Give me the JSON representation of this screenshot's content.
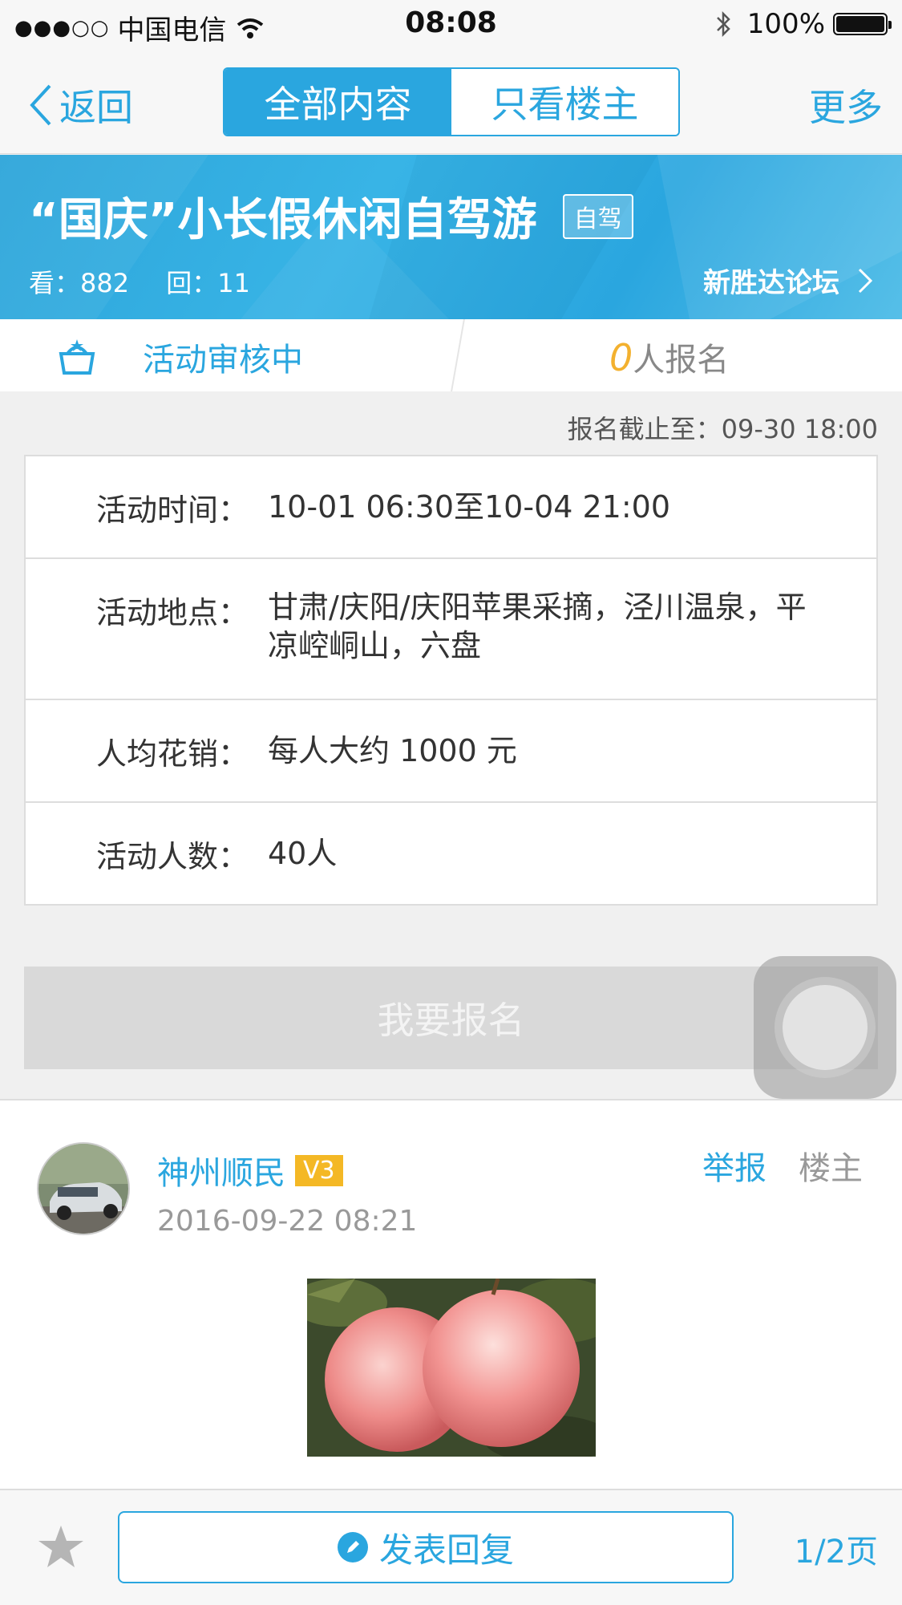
{
  "status_bar": {
    "signal": "●●●○○",
    "carrier": "中国电信",
    "time": "08:08",
    "battery": "100%"
  },
  "nav": {
    "back_label": "返回",
    "tabs": [
      {
        "label": "全部内容",
        "active": true
      },
      {
        "label": "只看楼主",
        "active": false
      }
    ],
    "more_label": "更多"
  },
  "banner": {
    "title": "“国庆”小长假休闲自驾游",
    "tag": "自驾",
    "views": "看：882",
    "replies": "回：11",
    "forum": "新胜达论坛"
  },
  "activity": {
    "status": "活动审核中",
    "signup_count": "0",
    "signup_suffix": "人报名",
    "deadline": "报名截止至：09-30 18:00"
  },
  "info": [
    {
      "label": "活动时间：",
      "value": "10-01 06:30至10-04 21:00"
    },
    {
      "label": "活动地点：",
      "value": "甘肃/庆阳/庆阳苹果采摘，泾川温泉，平凉崆峒山，六盘"
    },
    {
      "label": "人均花销：",
      "value": "每人大约 1000 元"
    },
    {
      "label": "活动人数：",
      "value": "40人"
    }
  ],
  "signup_button": "我要报名",
  "post": {
    "author": "神州顺民",
    "level": "V3",
    "date": "2016-09-22 08:21",
    "report_label": "举报",
    "owner_label": "楼主"
  },
  "toolbar": {
    "reply_label": "发表回复",
    "page": "1/2页"
  },
  "colors": {
    "accent": "#2aa6df",
    "badge": "#f4b825",
    "signup_count": "#f3b12f"
  }
}
